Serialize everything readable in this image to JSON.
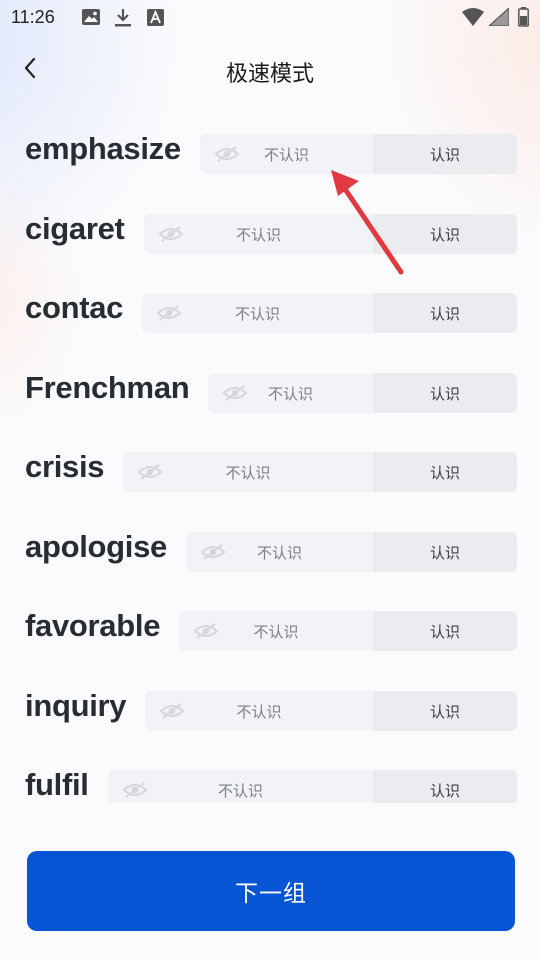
{
  "status_bar": {
    "time": "11:26",
    "left_icons": [
      "image-icon",
      "download-icon",
      "font-icon"
    ],
    "right_icons": [
      "wifi-icon",
      "signal-icon",
      "battery-icon"
    ]
  },
  "header": {
    "title": "极速模式",
    "back_icon": "chevron-left-icon"
  },
  "words": [
    {
      "word": "emphasize",
      "unknown_label": "不认识",
      "known_label": "认识"
    },
    {
      "word": "cigaret",
      "unknown_label": "不认识",
      "known_label": "认识"
    },
    {
      "word": "contac",
      "unknown_label": "不认识",
      "known_label": "认识"
    },
    {
      "word": "Frenchman",
      "unknown_label": "不认识",
      "known_label": "认识"
    },
    {
      "word": "crisis",
      "unknown_label": "不认识",
      "known_label": "认识"
    },
    {
      "word": "apologise",
      "unknown_label": "不认识",
      "known_label": "认识"
    },
    {
      "word": "favorable",
      "unknown_label": "不认识",
      "known_label": "认识"
    },
    {
      "word": "inquiry",
      "unknown_label": "不认识",
      "known_label": "认识"
    },
    {
      "word": "fulfil",
      "unknown_label": "不认识",
      "known_label": "认识"
    }
  ],
  "next_button": {
    "label": "下一组"
  },
  "colors": {
    "primary": "#0755d4",
    "annotation_arrow": "#e0393f"
  }
}
